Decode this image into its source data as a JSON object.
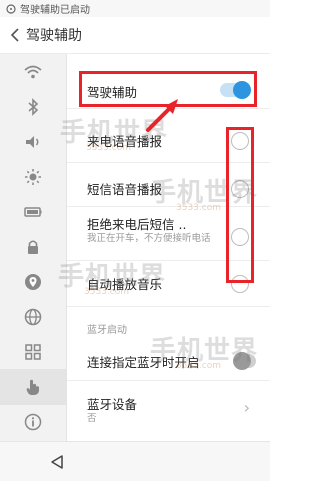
{
  "status_bar": {
    "text": "驾驶辅助已启动"
  },
  "header": {
    "title": "驾驶辅助"
  },
  "sidebar": {
    "items": [
      {
        "icon": "wifi-icon"
      },
      {
        "icon": "bluetooth-icon"
      },
      {
        "icon": "volume-icon"
      },
      {
        "icon": "brightness-icon"
      },
      {
        "icon": "battery-icon"
      },
      {
        "icon": "lock-icon"
      },
      {
        "icon": "location-icon"
      },
      {
        "icon": "globe-icon"
      },
      {
        "icon": "apps-grid-icon"
      },
      {
        "icon": "hand-gesture-icon",
        "active": true
      },
      {
        "icon": "info-icon"
      }
    ]
  },
  "settings": {
    "master": {
      "label": "驾驶辅助",
      "enabled": true
    },
    "call_voice": {
      "label": "来电语音播报",
      "checked": false
    },
    "sms_voice": {
      "label": "短信语音播报",
      "checked": false
    },
    "reject_sms": {
      "label": "拒绝来电后短信 ..",
      "sub": "我正在开车，不方便接听电话",
      "checked": false
    },
    "auto_music": {
      "label": "自动播放音乐",
      "checked": false
    },
    "bt_section": {
      "title": "蓝牙启动"
    },
    "bt_connect": {
      "label": "连接指定蓝牙时开启",
      "enabled": false
    },
    "bt_device": {
      "label": "蓝牙设备",
      "value": "否"
    }
  },
  "watermark": {
    "text": "手机世界",
    "sub": "3533.com"
  },
  "colors": {
    "accent": "#2d95e0",
    "highlight": "#e8232a"
  }
}
